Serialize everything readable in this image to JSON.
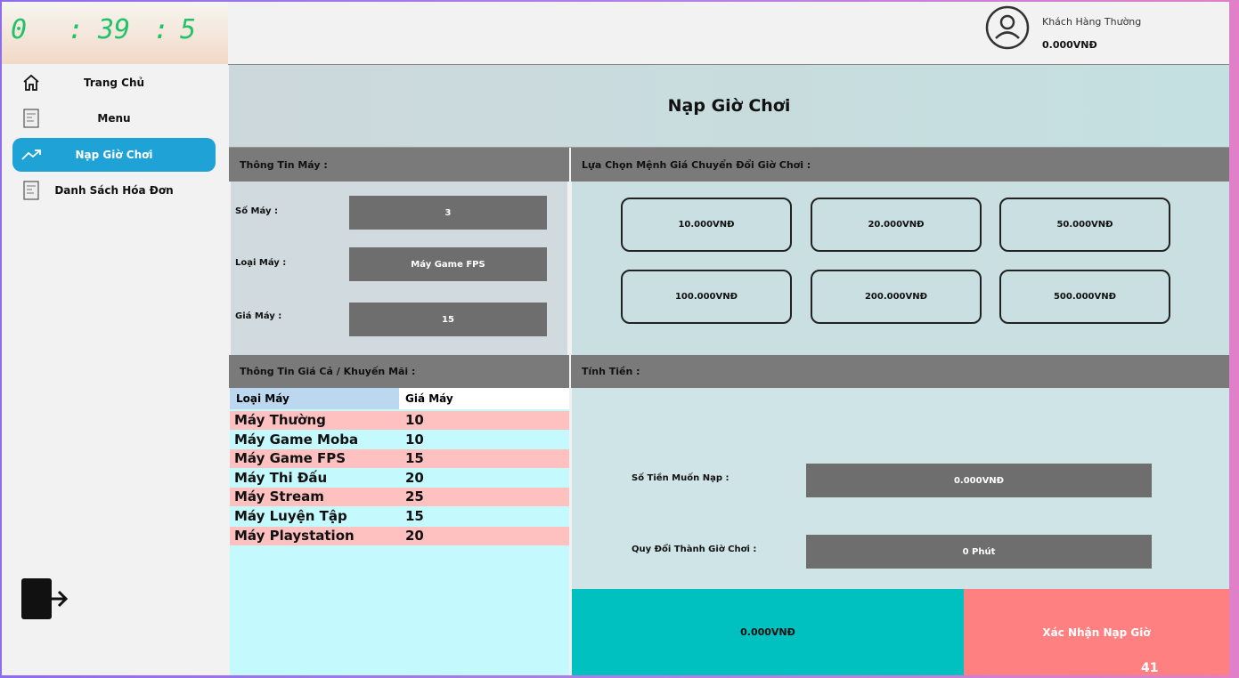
{
  "clock": {
    "hours": "0",
    "sep1": ":",
    "minutes": "39",
    "sep2": ":",
    "seconds": "5"
  },
  "user": {
    "rank": "Khách Hàng Thường",
    "balance": "0.000VNĐ"
  },
  "sidebar": {
    "items": [
      {
        "label": "Trang Chủ",
        "icon": "home-icon"
      },
      {
        "label": "Menu",
        "icon": "document-icon"
      },
      {
        "label": "Nạp Giờ Chơi",
        "icon": "trend-up-icon",
        "active": true
      },
      {
        "label": "Danh Sách Hóa Đơn",
        "icon": "document-icon"
      }
    ],
    "logout_icon": "logout-icon"
  },
  "main": {
    "title": "Nạp Giờ Chơi",
    "machine_info": {
      "heading": "Thông Tin Máy :",
      "fields": [
        {
          "label": "Số Máy :",
          "value": "3"
        },
        {
          "label": "Loại Máy :",
          "value": "Máy Game FPS"
        },
        {
          "label": "Giá Máy :",
          "value": "15"
        }
      ]
    },
    "denominations": {
      "heading": "Lựa Chọn Mệnh Giá Chuyển Đổi Giờ Chơi :",
      "options": [
        "10.000VNĐ",
        "20.000VNĐ",
        "50.000VNĐ",
        "100.000VNĐ",
        "200.000VNĐ",
        "500.000VNĐ"
      ]
    },
    "price_table": {
      "heading": "Thông Tin Giá Cả / Khuyến Mãi :",
      "columns": [
        "Loại Máy",
        "Giá Máy"
      ],
      "rows": [
        {
          "name": "Máy Thường",
          "price": "10"
        },
        {
          "name": "Máy Game Moba",
          "price": "10"
        },
        {
          "name": "Máy Game FPS",
          "price": "15"
        },
        {
          "name": "Máy Thi Đấu",
          "price": "20"
        },
        {
          "name": "Máy Stream",
          "price": "25"
        },
        {
          "name": "Máy Luyện Tập",
          "price": "15"
        },
        {
          "name": "Máy Playstation",
          "price": "20"
        }
      ]
    },
    "calc": {
      "heading": "Tính Tiền :",
      "amount_label": "Số Tiền Muốn Nạp :",
      "amount_value": "0.000VNĐ",
      "convert_label": "Quy Đổi Thành Giờ Chơi :",
      "convert_value": "0 Phút"
    },
    "total": "0.000VNĐ",
    "confirm_label": "Xác Nhận Nạp Giờ"
  },
  "page_number": "41",
  "colors": {
    "accent": "#1fa3d6",
    "clock": "#22c26a",
    "total_bg": "#00c0c0",
    "confirm_bg": "#ff8080",
    "row_pink": "#ffc0c0",
    "row_cyan": "#c4fafd"
  }
}
